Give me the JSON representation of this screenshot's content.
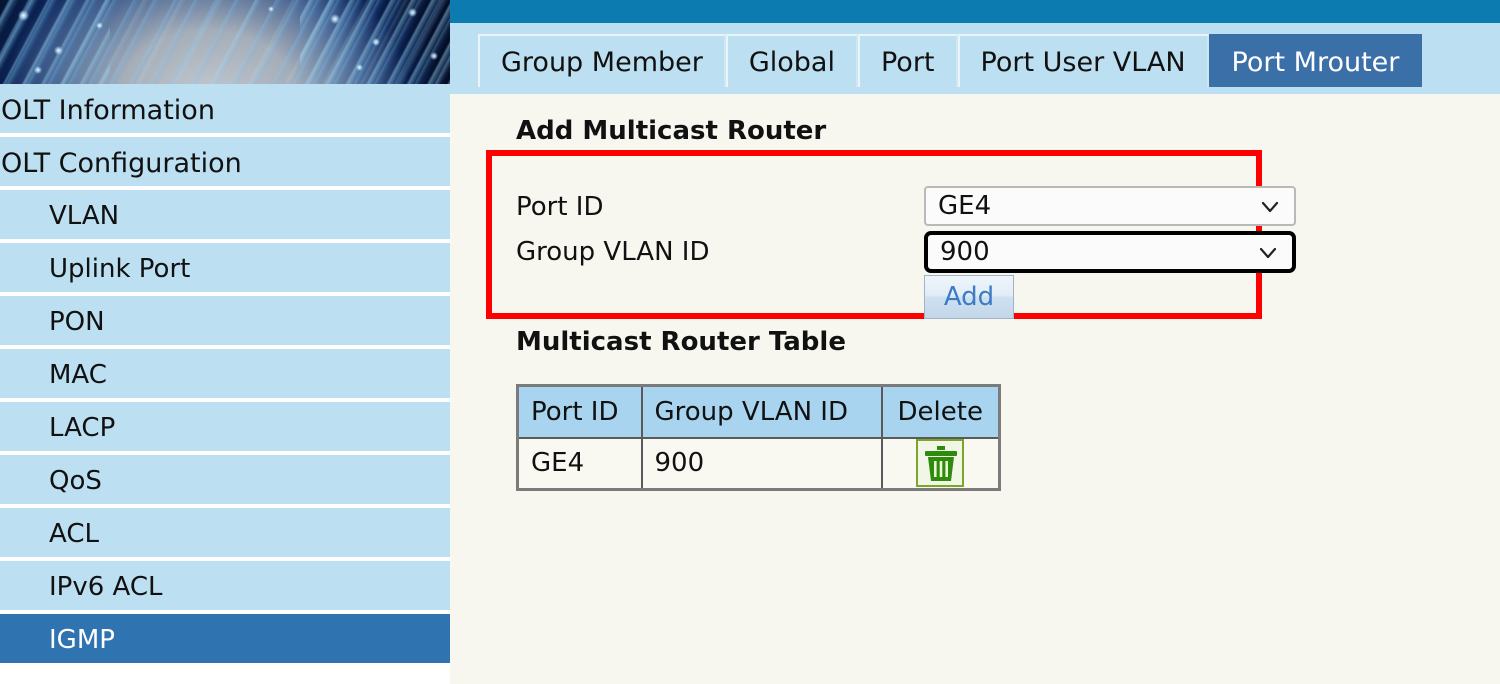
{
  "colors": {
    "topbar": "#0b7bb0",
    "sidebar_item": "#bcdff1",
    "sidebar_active": "#2f73b0",
    "tab_active": "#3a6fa8",
    "content_bg": "#f7f7ef",
    "highlight_box": "#ff0000",
    "table_header": "#a8d4ef",
    "add_button_text": "#3b7cc4",
    "trash_icon": "#2e8b0b",
    "cursor": "#aaff22"
  },
  "sidebar": {
    "banner_icon": "globe-banner-image",
    "items": [
      {
        "label": "OLT Information",
        "level": 0,
        "active": false
      },
      {
        "label": "OLT Configuration",
        "level": 0,
        "active": false
      },
      {
        "label": "VLAN",
        "level": 1,
        "active": false
      },
      {
        "label": "Uplink Port",
        "level": 1,
        "active": false
      },
      {
        "label": "PON",
        "level": 1,
        "active": false
      },
      {
        "label": "MAC",
        "level": 1,
        "active": false
      },
      {
        "label": "LACP",
        "level": 1,
        "active": false
      },
      {
        "label": "QoS",
        "level": 1,
        "active": false
      },
      {
        "label": "ACL",
        "level": 1,
        "active": false
      },
      {
        "label": "IPv6 ACL",
        "level": 1,
        "active": false
      },
      {
        "label": "IGMP",
        "level": 1,
        "active": true
      }
    ]
  },
  "tabs": [
    {
      "label": "Group Member",
      "active": false
    },
    {
      "label": "Global",
      "active": false
    },
    {
      "label": "Port",
      "active": false
    },
    {
      "label": "Port User VLAN",
      "active": false
    },
    {
      "label": "Port Mrouter",
      "active": true
    }
  ],
  "add_form": {
    "title": "Add Multicast Router",
    "fields": [
      {
        "label": "Port ID",
        "value": "GE4",
        "focused": false,
        "icon": "chevron-down-icon"
      },
      {
        "label": "Group VLAN ID",
        "value": "900",
        "focused": true,
        "icon": "chevron-down-icon"
      }
    ],
    "submit_label": "Add"
  },
  "table": {
    "title": "Multicast Router Table",
    "columns": [
      "Port ID",
      "Group VLAN ID",
      "Delete"
    ],
    "rows": [
      {
        "port_id": "GE4",
        "group_vlan_id": "900",
        "delete_icon": "trash-icon"
      }
    ]
  }
}
